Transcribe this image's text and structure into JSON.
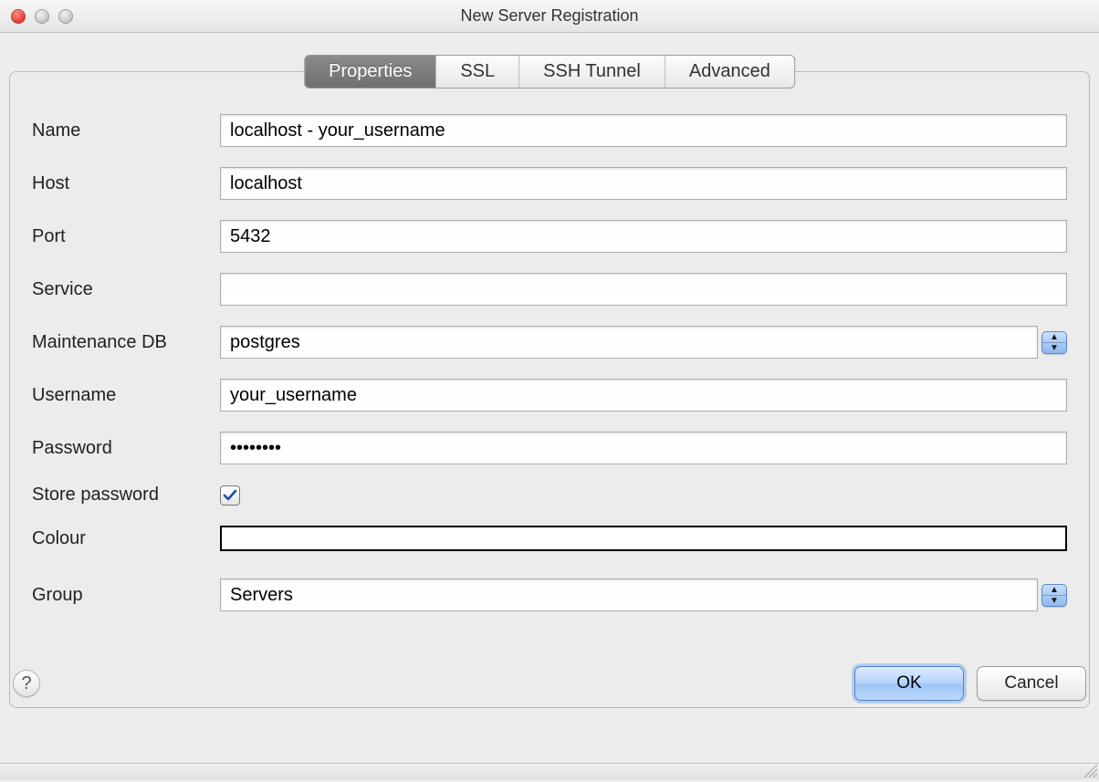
{
  "window": {
    "title": "New Server Registration"
  },
  "tabs": {
    "properties": "Properties",
    "ssl": "SSL",
    "ssh": "SSH Tunnel",
    "advanced": "Advanced"
  },
  "labels": {
    "name": "Name",
    "host": "Host",
    "port": "Port",
    "service": "Service",
    "maintenance_db": "Maintenance DB",
    "username": "Username",
    "password": "Password",
    "store_password": "Store password",
    "colour": "Colour",
    "group": "Group"
  },
  "fields": {
    "name": "localhost - your_username",
    "host": "localhost",
    "port": "5432",
    "service": "",
    "maintenance_db": "postgres",
    "username": "your_username",
    "password": "••••••••",
    "store_password_checked": true,
    "colour": "#ffffff",
    "group": "Servers"
  },
  "buttons": {
    "help": "?",
    "ok": "OK",
    "cancel": "Cancel"
  }
}
